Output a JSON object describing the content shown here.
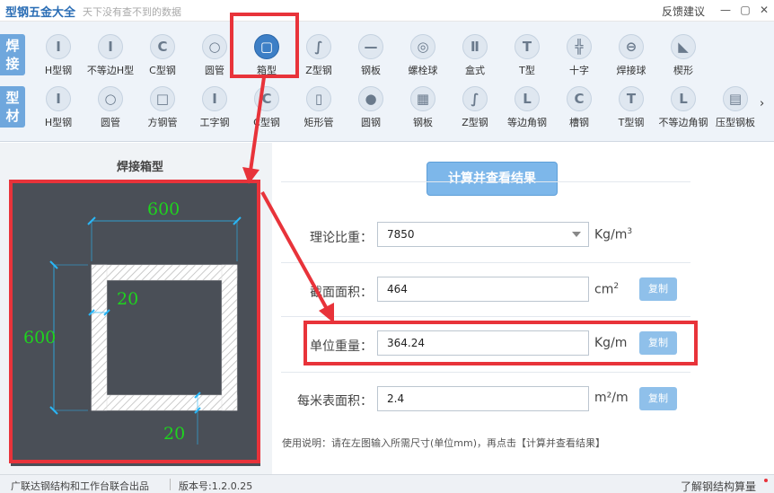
{
  "title_bar": {
    "app_title": "型钢五金大全",
    "app_subtitle": "天下没有查不到的数据",
    "feedback": "反馈建议",
    "minimize": "—",
    "restore": "▢",
    "close": "✕"
  },
  "toolbar": {
    "row1_label": "焊接",
    "row1_items": [
      "H型钢",
      "不等边H型",
      "C型钢",
      "圆管",
      "箱型",
      "Z型钢",
      "钢板",
      "螺栓球",
      "盒式",
      "T型",
      "十字",
      "焊接球",
      "楔形"
    ],
    "row1_glyphs": [
      "I",
      "I",
      "C",
      "○",
      "▢",
      "∫",
      "—",
      "◎",
      "Ⅱ",
      "T",
      "╬",
      "⊖",
      "◣"
    ],
    "row2_label": "型材",
    "row2_items": [
      "H型钢",
      "圆管",
      "方钢管",
      "工字钢",
      "C型钢",
      "矩形管",
      "圆钢",
      "钢板",
      "Z型钢",
      "等边角钢",
      "槽钢",
      "T型钢",
      "不等边角钢",
      "压型钢板"
    ],
    "row2_glyphs": [
      "I",
      "○",
      "□",
      "I",
      "C",
      "▯",
      "●",
      "▦",
      "∫",
      "L",
      "C",
      "T",
      "L",
      "▤"
    ],
    "active_item": "箱型",
    "scroll_arrow": "›"
  },
  "diagram": {
    "title": "焊接箱型",
    "width_label": "600",
    "height_label": "600",
    "wall_top_label": "20",
    "wall_bottom_label": "20"
  },
  "form": {
    "calc_button": "计算并查看结果",
    "rows": [
      {
        "label": "理论比重：",
        "value": "7850",
        "unit": "Kg/m",
        "unit_sup": "3",
        "copy": ""
      },
      {
        "label": "截面面积：",
        "value": "464",
        "unit": "cm",
        "unit_sup": "2",
        "copy": "复制"
      },
      {
        "label": "单位重量：",
        "value": "364.24",
        "unit": "Kg/m",
        "unit_sup": "",
        "copy": "复制"
      },
      {
        "label": "每米表面积：",
        "value": "2.4",
        "unit": "m²/m",
        "unit_sup": "",
        "copy": "复制"
      }
    ],
    "usage": "使用说明：请在左图输入所需尺寸(单位mm)，再点击【计算并查看结果】"
  },
  "status_bar": {
    "credit": "广联达钢结构和工作台联合出品",
    "version": "版本号:1.2.0.25",
    "learn_more": "了解钢结构算量"
  },
  "colors": {
    "accent": "#3d7fc6",
    "annotation_red": "#e8333a",
    "diagram_bg": "#4a4f57",
    "dimension_green": "#1ed41e",
    "dimension_cyan": "#29b6f6"
  }
}
